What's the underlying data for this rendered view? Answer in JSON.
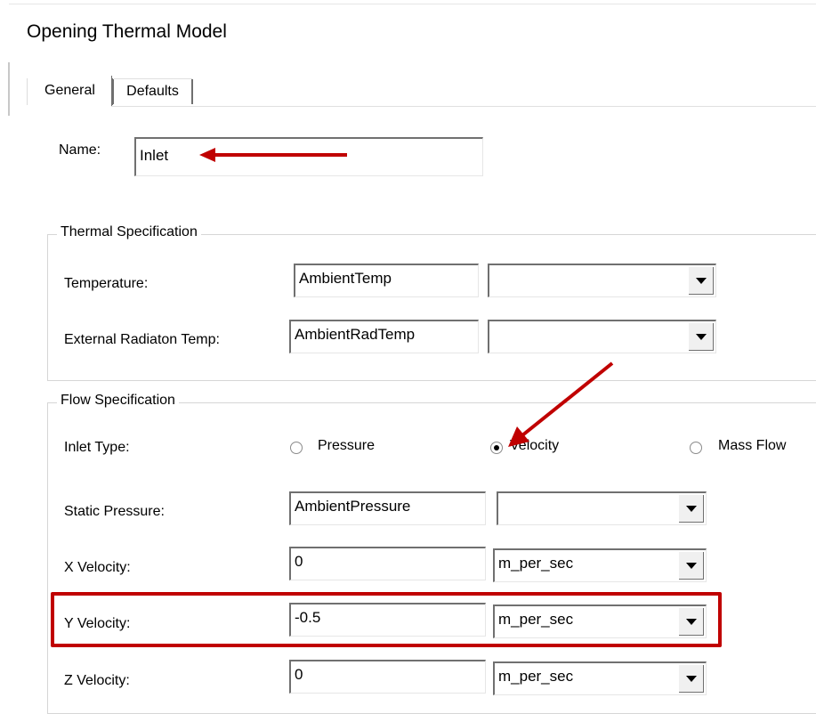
{
  "window": {
    "title": "Opening Thermal Model"
  },
  "tabs": [
    {
      "label": "General",
      "active": true
    },
    {
      "label": "Defaults",
      "active": false
    }
  ],
  "name_field": {
    "label": "Name:",
    "value": "Inlet"
  },
  "thermal": {
    "title": "Thermal Specification",
    "rows": [
      {
        "label": "Temperature:",
        "value": "AmbientTemp",
        "unit": ""
      },
      {
        "label": "External Radiaton Temp:",
        "value": "AmbientRadTemp",
        "unit": ""
      }
    ]
  },
  "flow": {
    "title": "Flow Specification",
    "inlet_type": {
      "label": "Inlet Type:",
      "options": [
        "Pressure",
        "Velocity",
        "Mass Flow"
      ],
      "selected": "Velocity"
    },
    "rows": [
      {
        "label": "Static Pressure:",
        "value": "AmbientPressure",
        "unit": ""
      },
      {
        "label": "X Velocity:",
        "value": "0",
        "unit": "m_per_sec"
      },
      {
        "label": "Y Velocity:",
        "value": "-0.5",
        "unit": "m_per_sec"
      },
      {
        "label": "Z Velocity:",
        "value": "0",
        "unit": "m_per_sec"
      }
    ]
  },
  "colors": {
    "annotation": "#c00000",
    "group_border": "#d6d6d6"
  },
  "annotations": [
    "arrow-to-name-field",
    "arrow-to-velocity-radio",
    "highlight-y-velocity-row"
  ]
}
